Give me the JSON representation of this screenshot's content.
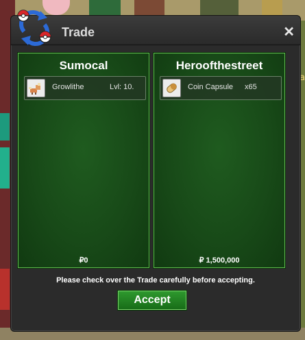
{
  "window": {
    "title": "Trade",
    "close_glyph": "✕",
    "logo_icon": "trade-pokeball-swap-icon"
  },
  "left_panel": {
    "name": "Sumocal",
    "item": {
      "icon": "growlithe-icon",
      "name": "Growlithe",
      "extra": "Lvl: 10."
    },
    "money": "₽0"
  },
  "right_panel": {
    "name": "Heroofthestreet",
    "item": {
      "icon": "coin-capsule-icon",
      "name": "Coin Capsule",
      "extra": "x65"
    },
    "money": "₽ 1,500,000"
  },
  "notice": "Please check over the Trade carefully before accepting.",
  "accept_label": "Accept",
  "background": {
    "edge_text": "Ca"
  },
  "colors": {
    "panel_green": "#184a18",
    "panel_border": "#5fbf4d",
    "accept_green": "#2f9a2f",
    "window_bg": "#2b2b2b"
  }
}
